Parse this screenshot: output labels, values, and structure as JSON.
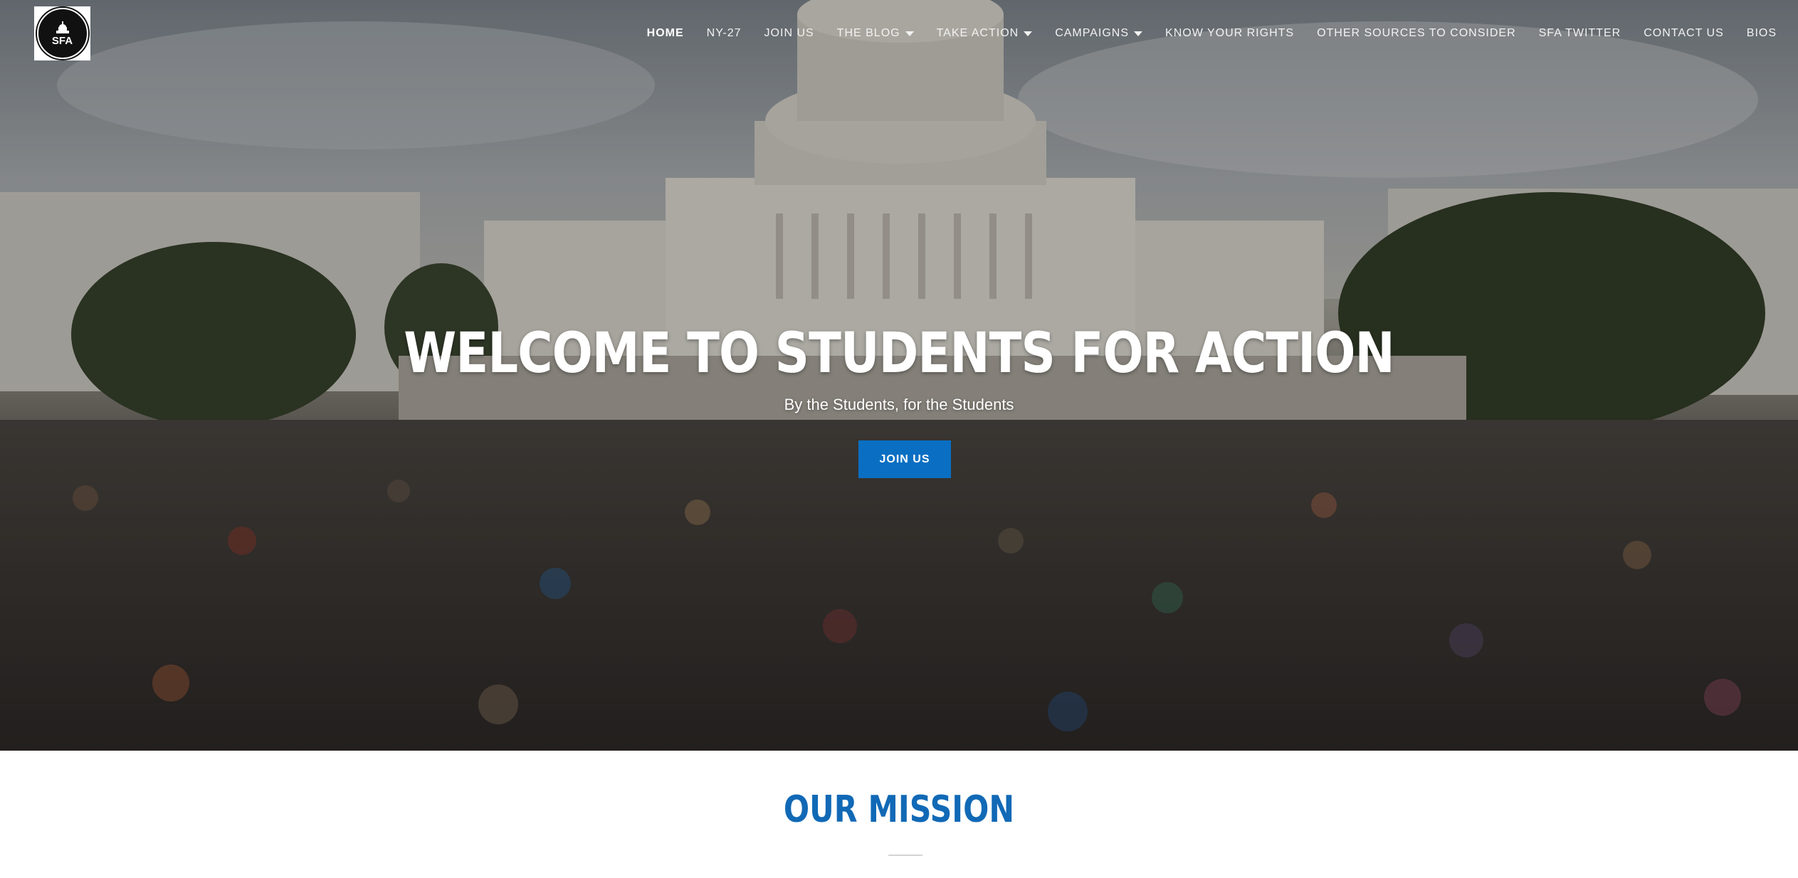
{
  "logo": {
    "text": "SFA"
  },
  "nav": {
    "items": [
      {
        "label": "HOME",
        "active": true,
        "dropdown": false
      },
      {
        "label": "NY-27",
        "active": false,
        "dropdown": false
      },
      {
        "label": "JOIN US",
        "active": false,
        "dropdown": false
      },
      {
        "label": "THE BLOG",
        "active": false,
        "dropdown": true
      },
      {
        "label": "TAKE ACTION",
        "active": false,
        "dropdown": true
      },
      {
        "label": "CAMPAIGNS",
        "active": false,
        "dropdown": true
      },
      {
        "label": "KNOW YOUR RIGHTS",
        "active": false,
        "dropdown": false
      },
      {
        "label": "OTHER SOURCES TO CONSIDER",
        "active": false,
        "dropdown": false
      },
      {
        "label": "SFA TWITTER",
        "active": false,
        "dropdown": false
      },
      {
        "label": "CONTACT US",
        "active": false,
        "dropdown": false
      },
      {
        "label": "BIOS",
        "active": false,
        "dropdown": false
      }
    ]
  },
  "hero": {
    "title": "WELCOME TO STUDENTS FOR ACTION",
    "subtitle": "By the Students, for the Students",
    "button_label": "JOIN US"
  },
  "mission": {
    "title": "OUR MISSION"
  },
  "colors": {
    "accent": "#0a6fc2",
    "mission_title": "#1169b6"
  }
}
